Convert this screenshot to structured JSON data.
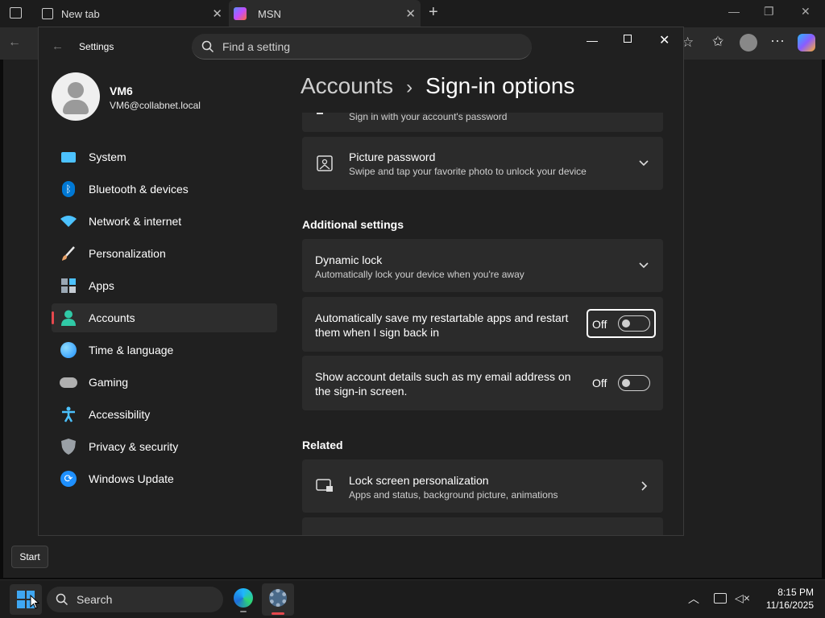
{
  "browser": {
    "tabs": [
      {
        "label": "New tab"
      },
      {
        "label": "MSN"
      }
    ],
    "new_tab_symbol": "+"
  },
  "settings": {
    "window_title": "Settings",
    "search_placeholder": "Find a setting",
    "user": {
      "name": "VM6",
      "email": "VM6@collabnet.local"
    },
    "breadcrumb": {
      "parent": "Accounts",
      "separator": "›",
      "current": "Sign-in options"
    },
    "nav": [
      {
        "label": "System",
        "icon": "monitor-icon",
        "color": "#4cc2ff"
      },
      {
        "label": "Bluetooth & devices",
        "icon": "bluetooth-icon",
        "color": "#0078d4"
      },
      {
        "label": "Network & internet",
        "icon": "wifi-icon",
        "color": "#4cc2ff"
      },
      {
        "label": "Personalization",
        "icon": "brush-icon",
        "color": "#e8a26a"
      },
      {
        "label": "Apps",
        "icon": "apps-icon",
        "color": "#9aa7b4"
      },
      {
        "label": "Accounts",
        "icon": "person-icon",
        "color": "#30c9a6"
      },
      {
        "label": "Time & language",
        "icon": "globe-icon",
        "color": "#4cc2ff"
      },
      {
        "label": "Gaming",
        "icon": "gamepad-icon",
        "color": "#b0b0b0"
      },
      {
        "label": "Accessibility",
        "icon": "accessibility-icon",
        "color": "#4cc2ff"
      },
      {
        "label": "Privacy & security",
        "icon": "shield-icon",
        "color": "#9aa0a6"
      },
      {
        "label": "Windows Update",
        "icon": "update-icon",
        "color": "#1e90ff"
      }
    ],
    "password_card_sub": "Sign in with your account's password",
    "picture_password": {
      "title": "Picture password",
      "sub": "Swipe and tap your favorite photo to unlock your device"
    },
    "additional_heading": "Additional settings",
    "dynamic_lock": {
      "title": "Dynamic lock",
      "sub": "Automatically lock your device when you're away"
    },
    "restart_apps": {
      "title": "Automatically save my restartable apps and restart them when I sign back in",
      "state": "Off"
    },
    "account_details": {
      "title": "Show account details such as my email address on the sign-in screen.",
      "state": "Off"
    },
    "related_heading": "Related",
    "lock_screen": {
      "title": "Lock screen personalization",
      "sub": "Apps and status, background picture, animations"
    }
  },
  "tooltip": {
    "label": "Start"
  },
  "taskbar": {
    "search_label": "Search",
    "time": "8:15 PM",
    "date": "11/16/2025"
  }
}
